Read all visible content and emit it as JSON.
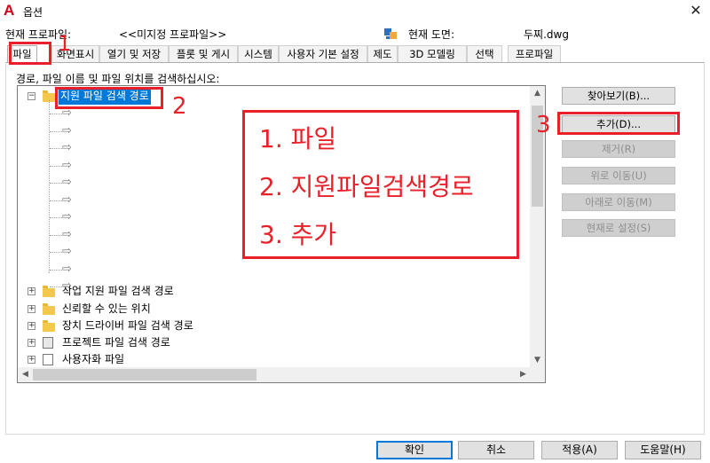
{
  "window": {
    "title": "옵션"
  },
  "profile": {
    "label": "현재 프로파일:",
    "value": "<<미지정 프로파일>>"
  },
  "drawing": {
    "label": "현재 도면:",
    "value": "두찌.dwg"
  },
  "tabs": [
    {
      "label": "파일",
      "active": true
    },
    {
      "label": "화면표시"
    },
    {
      "label": "열기 및 저장"
    },
    {
      "label": "플롯 및 게시"
    },
    {
      "label": "시스템"
    },
    {
      "label": "사용자 기본 설정"
    },
    {
      "label": "제도"
    },
    {
      "label": "3D 모델링"
    },
    {
      "label": "선택"
    },
    {
      "label": "프로파일"
    }
  ],
  "instruction": "경로, 파일 이름 및 파일 위치를 검색하십시오:",
  "tree": {
    "selected_node": "지원 파일 검색 경로",
    "child_count": 11,
    "nodes": [
      {
        "label": "작업 지원 파일 검색 경로",
        "icon": "folder-icon"
      },
      {
        "label": "신뢰할 수 있는 위치",
        "icon": "folder-icon"
      },
      {
        "label": "장치 드라이버 파일 검색 경로",
        "icon": "folder-icon"
      },
      {
        "label": "프로젝트 파일 검색 경로",
        "icon": "project-icon"
      },
      {
        "label": "사용자화 파일",
        "icon": "customization-icon"
      }
    ]
  },
  "buttons": {
    "browse": "찾아보기(B)...",
    "add": "추가(D)...",
    "remove": "제거(R)",
    "move_up": "위로 이동(U)",
    "move_down": "아래로 이동(M)",
    "set_current": "현재로 설정(S)"
  },
  "footer": {
    "ok": "확인",
    "cancel": "취소",
    "apply": "적용(A)",
    "help": "도움말(H)"
  },
  "annotations": {
    "num1": "1",
    "num2": "2",
    "num3": "3",
    "step1": "1. 파일",
    "step2": "2. 지원파일검색경로",
    "step3": "3. 추가"
  },
  "colors": {
    "annotation": "#e8202a",
    "selection": "#0078d7"
  }
}
